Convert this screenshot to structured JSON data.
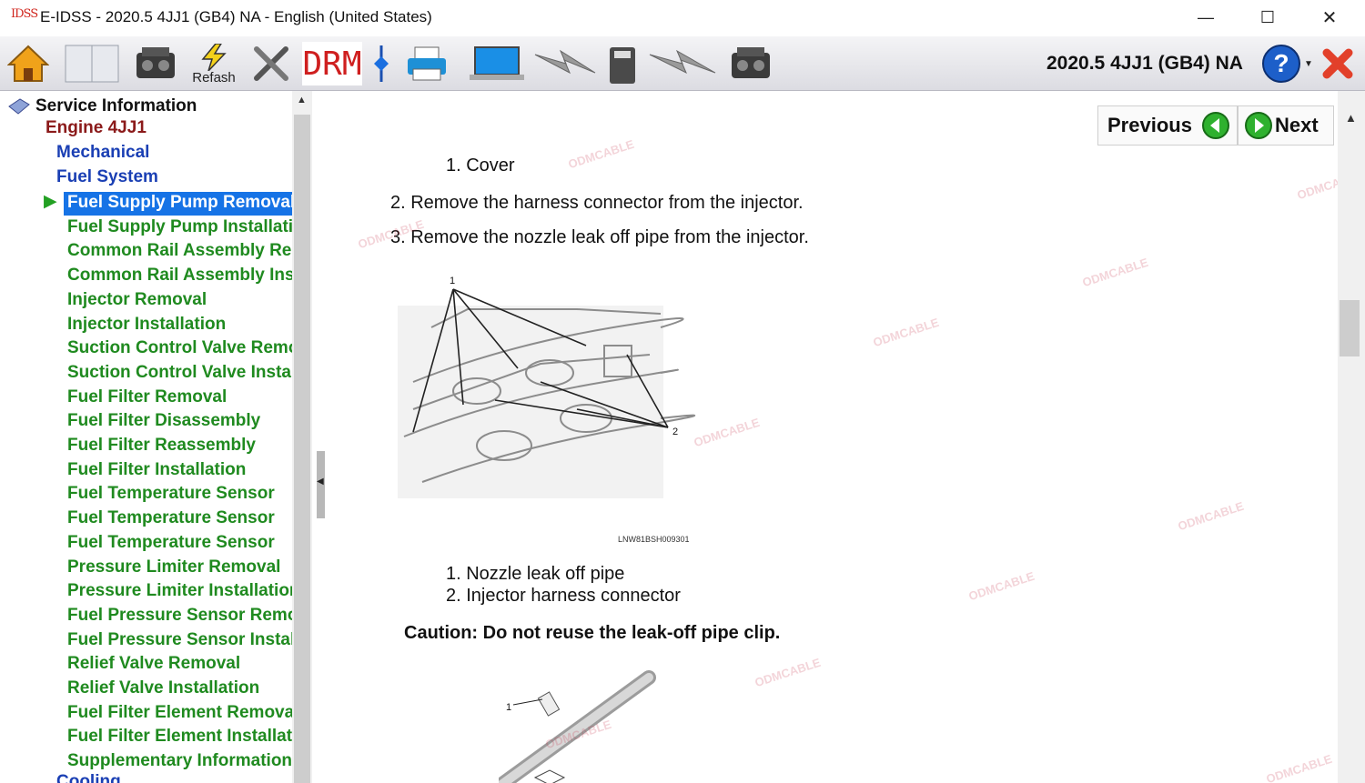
{
  "window": {
    "app_icon_text": "IDSS",
    "title": "E-IDSS - 2020.5 4JJ1 (GB4)  NA - English (United States)",
    "minimize": "—",
    "maximize": "☐",
    "close": "✕"
  },
  "toolbar": {
    "refresh_label": "Refash",
    "drm_label": "DRM",
    "vehicle_label": "2020.5 4JJ1 (GB4)  NA",
    "help_label": "?",
    "icons": [
      "home-icon",
      "book-icon",
      "engine-icon",
      "refresh-icon",
      "tools-icon",
      "drm-icon",
      "arrow-icon",
      "printer-icon",
      "laptop-icon",
      "signal-icon",
      "device-icon",
      "signal-icon",
      "engine-icon",
      "help-icon",
      "exit-icon"
    ]
  },
  "tree": {
    "root": "Service Information",
    "engine": "Engine 4JJ1",
    "level2": [
      "Mechanical",
      "Fuel System"
    ],
    "items": [
      "Fuel Supply Pump Removal",
      "Fuel Supply Pump Installation",
      "Common Rail Assembly Removal",
      "Common Rail Assembly Installation",
      "Injector Removal",
      "Injector Installation",
      "Suction Control Valve Removal",
      "Suction Control Valve Installation",
      "Fuel Filter Removal",
      "Fuel Filter Disassembly",
      "Fuel Filter Reassembly",
      "Fuel Filter Installation",
      "Fuel Temperature Sensor",
      "Fuel Temperature Sensor",
      "Fuel Temperature Sensor",
      "Pressure Limiter Removal",
      "Pressure Limiter Installation",
      "Fuel Pressure Sensor Removal",
      "Fuel Pressure Sensor Installation",
      "Relief Valve Removal",
      "Relief Valve Installation",
      "Fuel Filter Element Removal",
      "Fuel Filter Element Installation",
      "Supplementary Information"
    ],
    "next_section": "Cooling",
    "selected_index": 0
  },
  "nav": {
    "previous": "Previous",
    "next": "Next"
  },
  "content": {
    "legend_top": "1.  Cover",
    "step2": "2. Remove the harness connector from the injector.",
    "step3": "3. Remove the nozzle leak off pipe from the injector.",
    "callout_1": "1",
    "callout_2": "2",
    "figure_code": "LNW81BSH009301",
    "legend_1": "1.  Nozzle leak off pipe",
    "legend_2": "2.  Injector harness connector",
    "caution": "Caution: Do not reuse the leak-off pipe clip.",
    "callout_fig2": "1"
  },
  "watermark": "ODMCABLE",
  "colors": {
    "tree_engine": "#8b1a1a",
    "tree_level2": "#1a3fb4",
    "tree_item": "#1f8a1f",
    "selected_bg": "#1673e6",
    "selected_fg": "#ffffff",
    "close_x": "#e2402a"
  }
}
